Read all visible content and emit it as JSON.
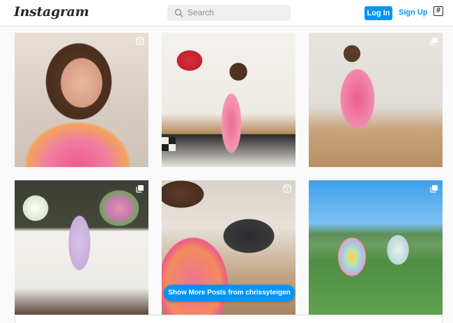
{
  "header": {
    "logo_text": "Instagram",
    "search_placeholder": "Search",
    "login_label": "Log In",
    "signup_label": "Sign Up",
    "hashtag_glyph": "#",
    "icons": [
      "search-icon",
      "hashtag-icon"
    ]
  },
  "grid": {
    "posts": [
      {
        "badge": "reel-icon"
      },
      {
        "badge": "none"
      },
      {
        "badge": "carousel-icon"
      },
      {
        "badge": "carousel-icon"
      },
      {
        "badge": "reel-icon"
      },
      {
        "badge": "carousel-icon"
      }
    ]
  },
  "more_button_label": "Show More Posts from chrissyteigen",
  "colors": {
    "accent": "#0095f6",
    "border": "#dbdbdb",
    "background": "#fafafa",
    "search_bg": "#efefef"
  }
}
